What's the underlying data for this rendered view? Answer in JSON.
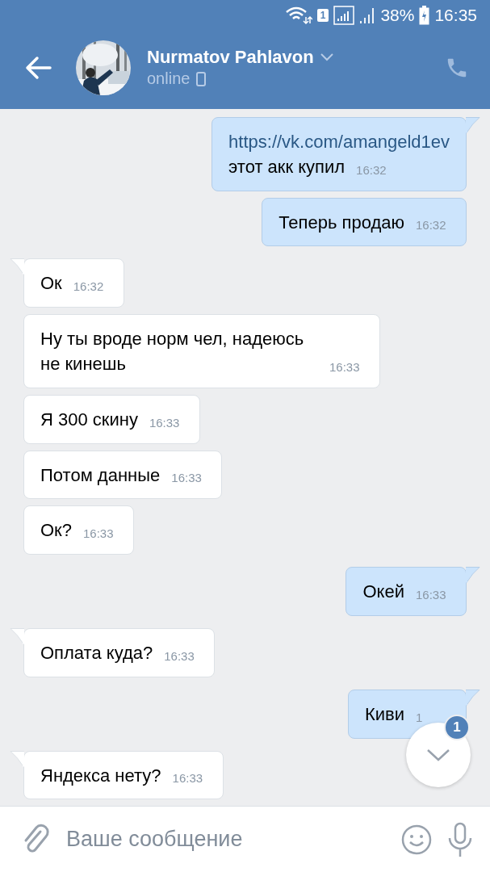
{
  "status_bar": {
    "sim": "1",
    "battery": "38%",
    "time": "16:35"
  },
  "header": {
    "name": "Nurmatov Pahlavon",
    "status": "online"
  },
  "messages": [
    {
      "kind": "outgoing",
      "tail": true,
      "link": "https://vk.com/amangeld1ev",
      "text": "этот акк купил",
      "time": "16:32"
    },
    {
      "kind": "outgoing",
      "tail": false,
      "text": "Теперь продаю",
      "time": "16:32"
    },
    {
      "kind": "incoming",
      "tail": true,
      "text": "Ок",
      "time": "16:32"
    },
    {
      "kind": "incoming",
      "tail": false,
      "text": "Ну ты вроде норм чел, надеюсь не кинешь",
      "time": "16:33"
    },
    {
      "kind": "incoming",
      "tail": false,
      "text": "Я 300 скину",
      "time": "16:33"
    },
    {
      "kind": "incoming",
      "tail": false,
      "text": "Потом данные",
      "time": "16:33"
    },
    {
      "kind": "incoming",
      "tail": false,
      "text": "Ок?",
      "time": "16:33"
    },
    {
      "kind": "outgoing",
      "tail": true,
      "text": "Окей",
      "time": "16:33"
    },
    {
      "kind": "incoming",
      "tail": true,
      "text": "Оплата куда?",
      "time": "16:33"
    },
    {
      "kind": "outgoing",
      "tail": true,
      "text": "Киви",
      "time": "1"
    },
    {
      "kind": "incoming",
      "tail": true,
      "text": "Яндекса нету?",
      "time": "16:33"
    }
  ],
  "scroll_button": {
    "badge": "1"
  },
  "composer": {
    "placeholder": "Ваше сообщение"
  }
}
